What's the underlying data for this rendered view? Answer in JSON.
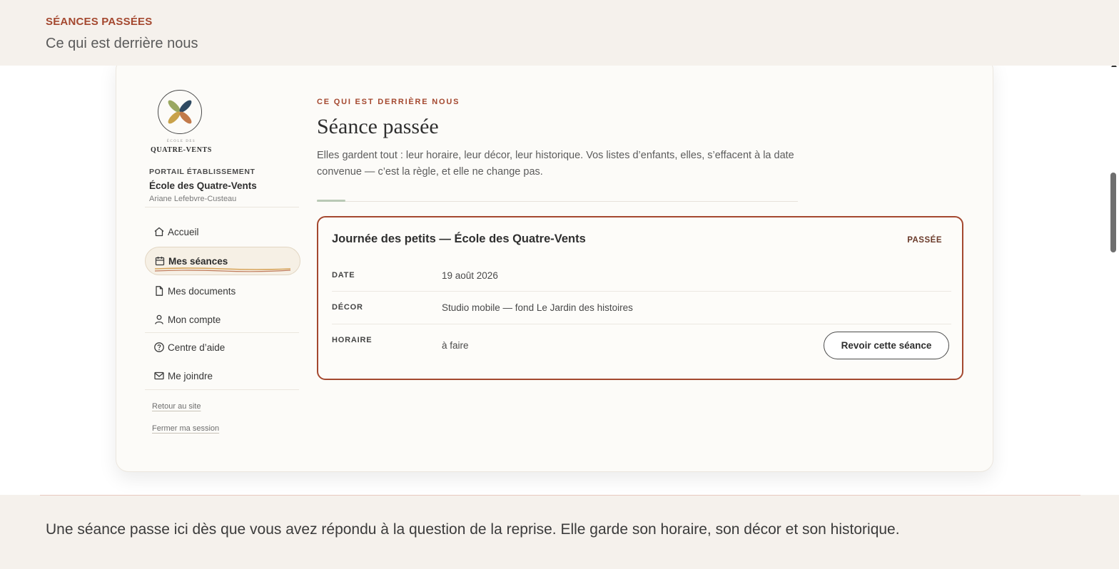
{
  "header": {
    "eyebrow": "SÉANCES PASSÉES",
    "subtitle": "Ce qui est derrière nous"
  },
  "sidebar": {
    "logo_small": "ÉCOLE DES",
    "logo_big": "QUATRE-VENTS",
    "portal_label": "PORTAIL ÉTABLISSEMENT",
    "school_name": "École des Quatre-Vents",
    "user_name": "Ariane Lefebvre-Custeau",
    "items": [
      {
        "label": "Accueil",
        "icon": "home-icon"
      },
      {
        "label": "Mes séances",
        "icon": "calendar-icon",
        "active": true
      },
      {
        "label": "Mes documents",
        "icon": "document-icon"
      },
      {
        "label": "Mon compte",
        "icon": "user-icon"
      },
      {
        "label": "Centre d’aide",
        "icon": "help-icon"
      },
      {
        "label": "Me joindre",
        "icon": "mail-icon"
      }
    ],
    "links": {
      "back": "Retour au site",
      "logout": "Fermer ma session"
    }
  },
  "main": {
    "eyebrow": "CE QUI EST DERRIÈRE NOUS",
    "title": "Séance passée",
    "description": "Elles gardent tout : leur horaire, leur décor, leur historique. Vos listes d’enfants, elles, s’effacent à la date convenue — c’est la règle, et elle ne change pas.",
    "session": {
      "title": "Journée des petits — École des Quatre-Vents",
      "badge": "PASSÉE",
      "rows": [
        {
          "label": "DATE",
          "value": "19 août 2026"
        },
        {
          "label": "DÉCOR",
          "value": "Studio mobile — fond Le Jardin des histoires"
        },
        {
          "label": "HORAIRE",
          "value": "à faire"
        }
      ],
      "button": "Revoir cette séance"
    }
  },
  "footer": {
    "text": "Une séance passe ici dès que vous avez répondu à la question de la reprise. Elle garde son horaire, son décor et son historique."
  },
  "colors": {
    "accent": "#a4482f",
    "background": "#f5f1ec",
    "card": "#fcfbf8"
  }
}
